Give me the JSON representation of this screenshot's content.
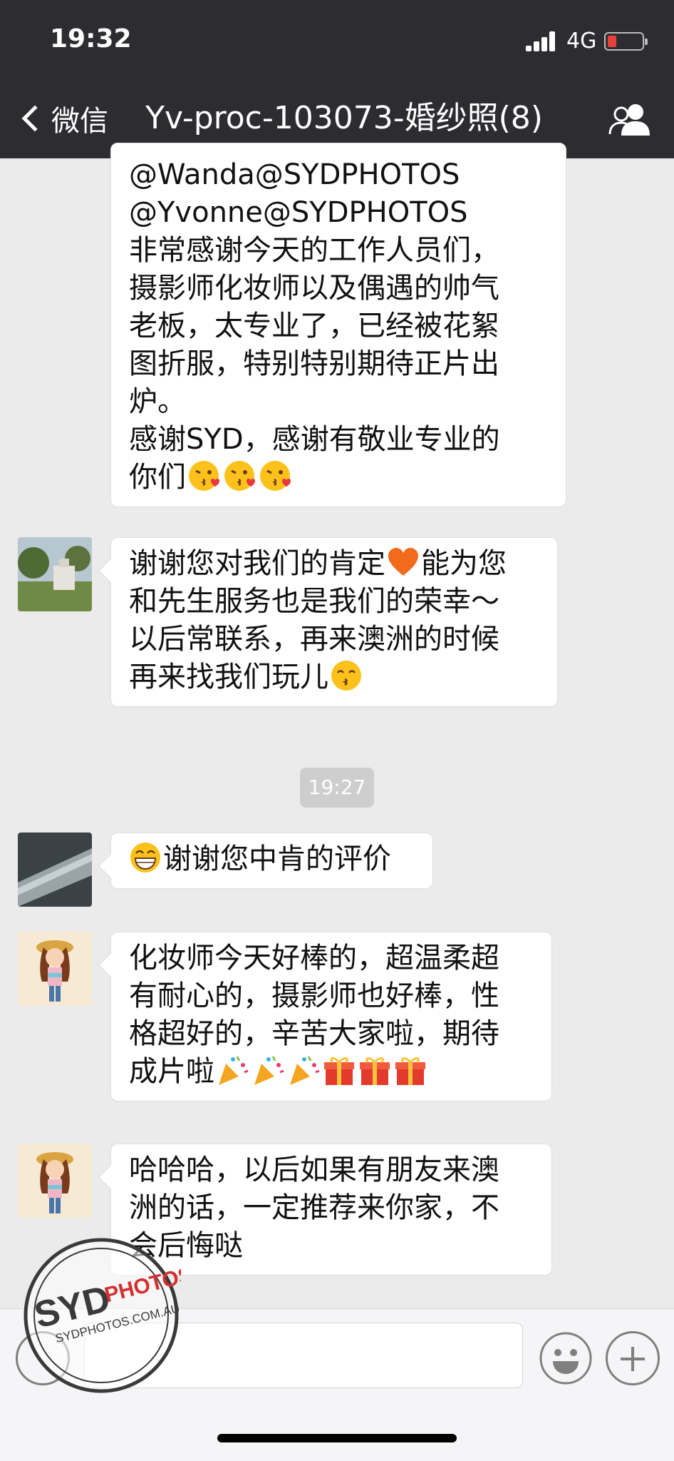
{
  "status_bar": {
    "time": "19:32",
    "network": "4G",
    "battery_level": 0.15,
    "battery_color": "#e8403a"
  },
  "nav": {
    "back_label": "微信",
    "title": "Yv-proc-103073-婚纱照(8)",
    "members_icon": "people-icon"
  },
  "messages": [
    {
      "sender_avatar": "partial-top",
      "lines": [
        "@Wanda@SYDPHOTOS",
        "@Yvonne@SYDPHOTOS",
        "非常感谢今天的工作人员们，",
        "摄影师化妆师以及偶遇的帅气",
        "老板，太专业了，已经被花絮",
        "图折服，特别特别期待正片出",
        "炉。",
        "感谢SYD，感谢有敬业专业的",
        "你们"
      ],
      "emojis": [
        "kiss-heart-emoji",
        "kiss-heart-emoji",
        "kiss-heart-emoji"
      ]
    },
    {
      "sender_avatar": "garden-photo-avatar",
      "lines": [
        "谢谢您对我们的肯定",
        "能为您",
        "和先生服务也是我们的荣幸～",
        "以后常联系，再来澳洲的时候",
        "再来找我们玩儿"
      ],
      "emojis": [
        "orange-heart-emoji",
        "kissing-emoji"
      ]
    },
    {
      "sender_avatar": "card-photo-avatar",
      "lines": [
        "谢谢您中肯的评价"
      ],
      "emojis": [
        "grin-emoji"
      ]
    },
    {
      "sender_avatar": "cartoon-girl-avatar",
      "lines": [
        "化妆师今天好棒的，超温柔超",
        "有耐心的，摄影师也好棒，性",
        "格超好的，辛苦大家啦，期待",
        "成片啦"
      ],
      "emojis": [
        "party-popper-emoji",
        "party-popper-emoji",
        "party-popper-emoji",
        "gift-emoji",
        "gift-emoji",
        "gift-emoji"
      ]
    },
    {
      "sender_avatar": "cartoon-girl-avatar",
      "lines": [
        "哈哈哈，以后如果有朋友来澳",
        "洲的话，一定推荐来你家，不",
        "会后悔哒"
      ],
      "emojis": []
    }
  ],
  "timestamp": "19:27",
  "watermark": {
    "brand": "SYD PHOTOS",
    "url": "SYDPHOTOS.COM.AU"
  }
}
